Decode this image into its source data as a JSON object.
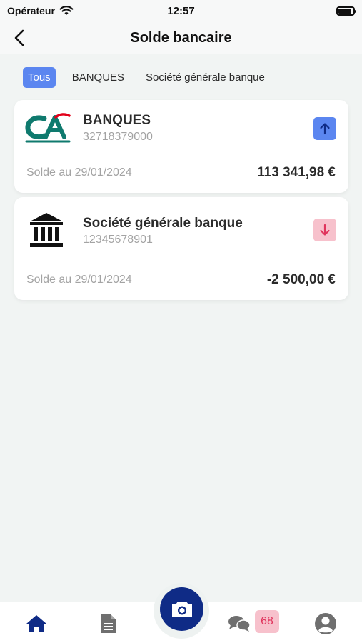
{
  "status_bar": {
    "carrier": "Opérateur",
    "time": "12:57"
  },
  "header": {
    "title": "Solde bancaire"
  },
  "filters": [
    {
      "label": "Tous",
      "active": true
    },
    {
      "label": "BANQUES",
      "active": false
    },
    {
      "label": "Société générale banque",
      "active": false
    }
  ],
  "accounts": [
    {
      "name": "BANQUES",
      "number": "32718379000",
      "logo": "credit-agricole-logo",
      "trend": "up",
      "balance_label": "Solde au 29/01/2024",
      "balance": "113 341,98 €"
    },
    {
      "name": "Société générale banque",
      "number": "12345678901",
      "logo": "bank-building-icon",
      "trend": "down",
      "balance_label": "Solde au 29/01/2024",
      "balance": "-2 500,00 €"
    }
  ],
  "bottom_nav": {
    "chat_badge": "68"
  },
  "colors": {
    "accent": "#5b86f0",
    "primary_dark": "#0f2b86",
    "negative_bg": "#f7c1cc",
    "negative_fg": "#e0345c",
    "ca_green": "#0f7a6e",
    "ca_red": "#e2001a"
  },
  "icons": [
    "back-icon",
    "wifi-icon",
    "battery-icon",
    "home-icon",
    "document-icon",
    "camera-icon",
    "chat-icon",
    "user-icon"
  ]
}
